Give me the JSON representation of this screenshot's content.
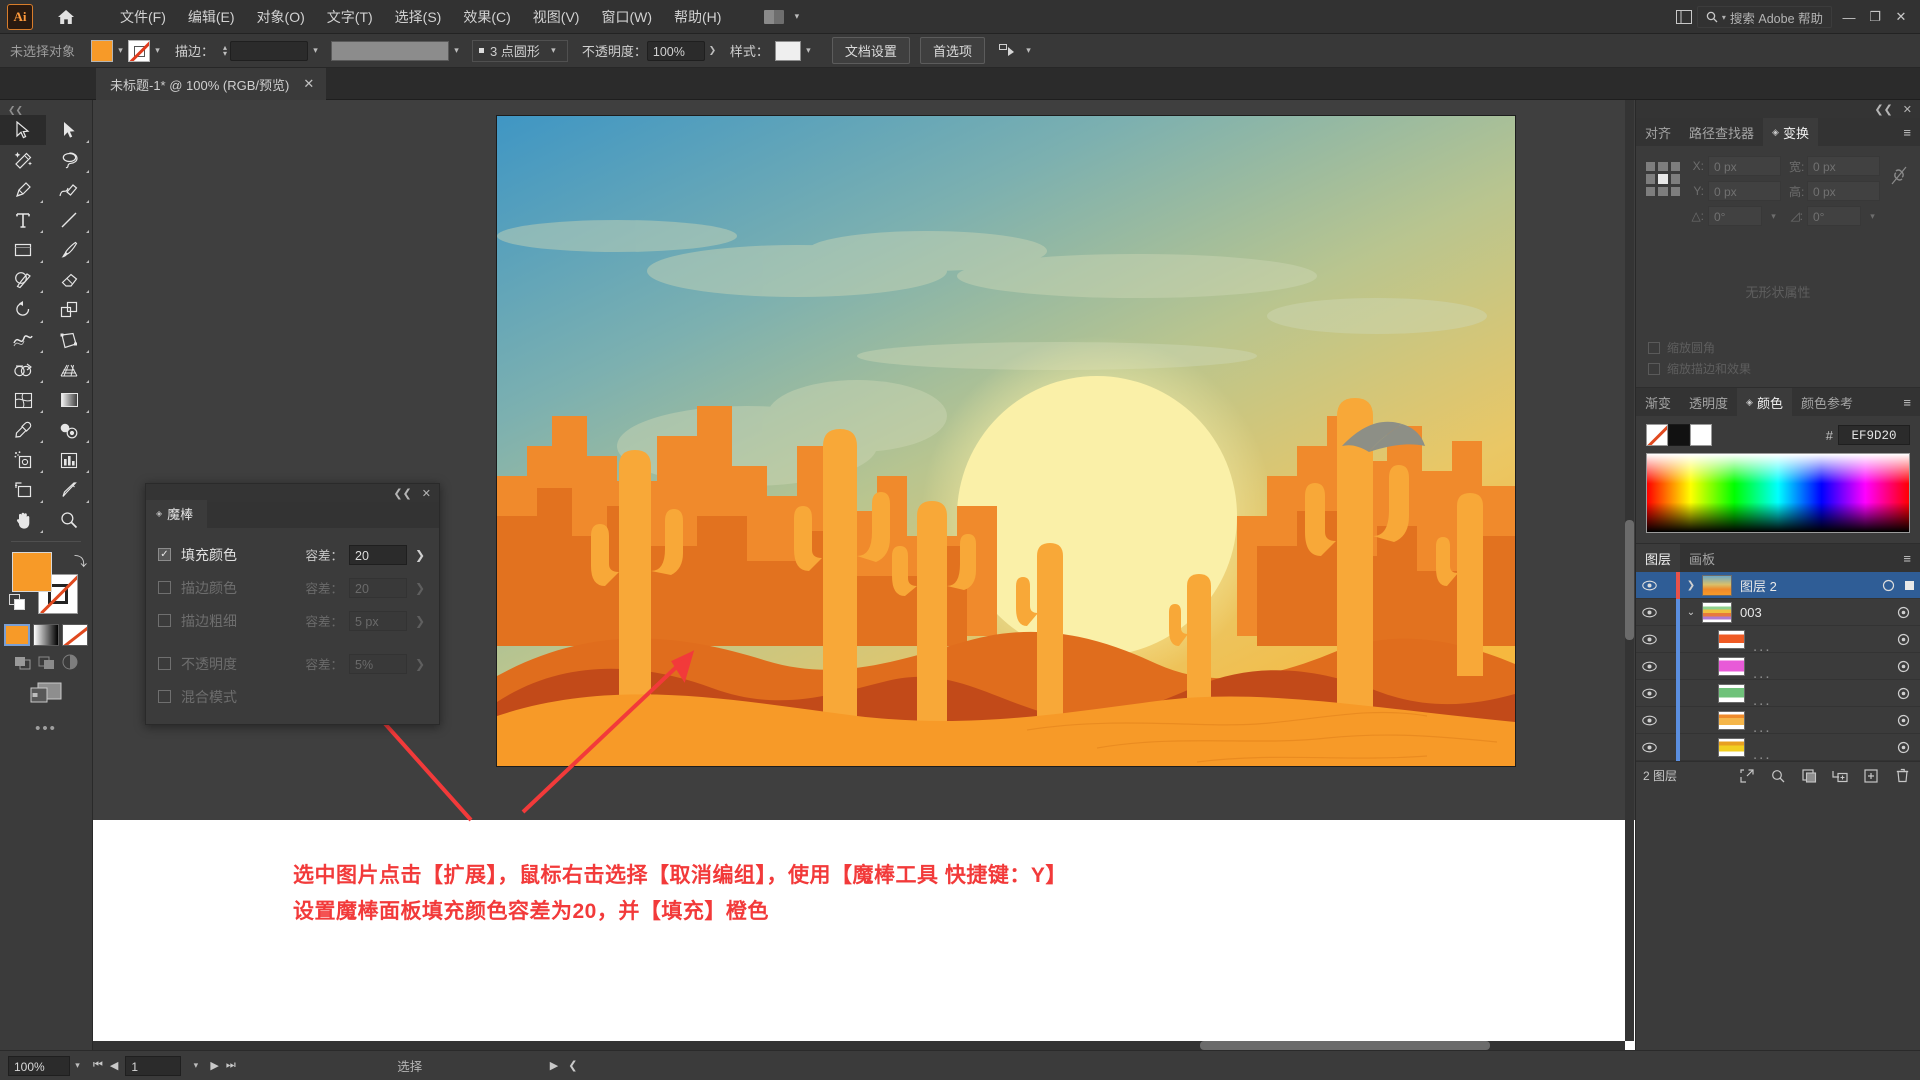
{
  "app": {
    "logo": "Ai",
    "home_icon": "home-icon"
  },
  "menubar": {
    "items": [
      "文件(F)",
      "编辑(E)",
      "对象(O)",
      "文字(T)",
      "选择(S)",
      "效果(C)",
      "视图(V)",
      "窗口(W)",
      "帮助(H)"
    ],
    "workspace_switcher": "workspace-icon",
    "search_placeholder": "搜索 Adobe 帮助",
    "panel_toggle_icon": "panel-toggle-icon",
    "minimize": "—",
    "restore": "❐",
    "close": "✕"
  },
  "controlbar": {
    "selection_status": "未选择对象",
    "fill_color": "#F79A28",
    "stroke_color": "none",
    "stroke_label": "描边：",
    "stroke_weight": "",
    "stroke_profile": "",
    "brush_definition": "3 点圆形",
    "opacity_label": "不透明度：",
    "opacity_value": "100%",
    "style_label": "样式：",
    "document_setup": "文档设置",
    "preferences": "首选项",
    "align_icon": "align-icon"
  },
  "document_tab": {
    "title": "未标题-1* @ 100% (RGB/预览)",
    "close": "✕"
  },
  "toolbar": {
    "tools": [
      {
        "name": "selection-tool",
        "glyph": "selection",
        "selected": true
      },
      {
        "name": "direct-selection-tool",
        "glyph": "direct-selection",
        "selected": false
      },
      {
        "name": "magic-wand-tool",
        "glyph": "magic-wand",
        "selected": false
      },
      {
        "name": "lasso-tool",
        "glyph": "lasso",
        "selected": false
      },
      {
        "name": "pen-tool",
        "glyph": "pen",
        "selected": false
      },
      {
        "name": "curvature-tool",
        "glyph": "curvature",
        "selected": false
      },
      {
        "name": "type-tool",
        "glyph": "type",
        "selected": false
      },
      {
        "name": "line-segment-tool",
        "glyph": "line",
        "selected": false
      },
      {
        "name": "rectangle-tool",
        "glyph": "rectangle",
        "selected": false
      },
      {
        "name": "paintbrush-tool",
        "glyph": "paintbrush",
        "selected": false
      },
      {
        "name": "shaper-tool",
        "glyph": "shaper",
        "selected": false
      },
      {
        "name": "eraser-tool",
        "glyph": "eraser",
        "selected": false
      },
      {
        "name": "rotate-tool",
        "glyph": "rotate",
        "selected": false
      },
      {
        "name": "scale-tool",
        "glyph": "scale",
        "selected": false
      },
      {
        "name": "width-tool",
        "glyph": "width",
        "selected": false
      },
      {
        "name": "free-transform-tool",
        "glyph": "free-transform",
        "selected": false
      },
      {
        "name": "shape-builder-tool",
        "glyph": "shape-builder",
        "selected": false
      },
      {
        "name": "perspective-grid-tool",
        "glyph": "perspective-grid",
        "selected": false
      },
      {
        "name": "mesh-tool",
        "glyph": "mesh",
        "selected": false
      },
      {
        "name": "gradient-tool",
        "glyph": "gradient",
        "selected": false
      },
      {
        "name": "eyedropper-tool",
        "glyph": "eyedropper",
        "selected": false
      },
      {
        "name": "blend-tool",
        "glyph": "blend",
        "selected": false
      },
      {
        "name": "symbol-sprayer-tool",
        "glyph": "symbol-sprayer",
        "selected": false
      },
      {
        "name": "column-graph-tool",
        "glyph": "column-graph",
        "selected": false
      },
      {
        "name": "artboard-tool",
        "glyph": "artboard",
        "selected": false
      },
      {
        "name": "slice-tool",
        "glyph": "slice",
        "selected": false
      },
      {
        "name": "hand-tool",
        "glyph": "hand",
        "selected": false
      },
      {
        "name": "zoom-tool",
        "glyph": "zoom",
        "selected": false
      }
    ],
    "fill_swatch": "#F79A28",
    "stroke_swatch": "none",
    "modes": [
      "color-mode",
      "gradient-mode",
      "none-mode"
    ],
    "more_tools": "•••"
  },
  "magic_wand_panel": {
    "tab_label": "魔棒",
    "collapse": "❮❮",
    "close": "✕",
    "rows": [
      {
        "label": "填充颜色",
        "checked": true,
        "tol_label": "容差：",
        "value": "20",
        "enabled": true
      },
      {
        "label": "描边颜色",
        "checked": false,
        "tol_label": "容差：",
        "value": "20",
        "enabled": false
      },
      {
        "label": "描边粗细",
        "checked": false,
        "tol_label": "容差：",
        "value": "5 px",
        "enabled": false
      },
      {
        "label": "不透明度",
        "checked": false,
        "tol_label": "容差：",
        "value": "5%",
        "enabled": false
      },
      {
        "label": "混合模式",
        "checked": false,
        "tol_label": "",
        "value": "",
        "enabled": false
      }
    ]
  },
  "transform_panel": {
    "collapse": "❮❮",
    "close": "✕",
    "tabs": [
      {
        "label": "对齐",
        "active": false
      },
      {
        "label": "路径查找器",
        "active": false
      },
      {
        "label": "变换",
        "active": true
      }
    ],
    "menu_icon": "panel-menu-icon",
    "fields": [
      {
        "key": "X:",
        "value": "0 px"
      },
      {
        "key": "宽:",
        "value": "0 px"
      },
      {
        "key": "Y:",
        "value": "0 px"
      },
      {
        "key": "高:",
        "value": "0 px"
      },
      {
        "key": "△:",
        "value": "0°"
      },
      {
        "key": "◿:",
        "value": "0°"
      }
    ],
    "link_icon": "link-broken-icon",
    "empty_text": "无形状属性",
    "checkboxes": [
      "缩放圆角",
      "缩放描边和效果"
    ]
  },
  "color_panel": {
    "tabs": [
      {
        "label": "渐变",
        "active": false
      },
      {
        "label": "透明度",
        "active": false
      },
      {
        "label": "颜色",
        "active": true
      },
      {
        "label": "颜色参考",
        "active": false
      }
    ],
    "menu_icon": "panel-menu-icon",
    "hash": "#",
    "hex": "EF9D20",
    "swatches": [
      "none",
      "black",
      "white"
    ]
  },
  "layers_panel": {
    "tabs": [
      {
        "label": "图层",
        "active": true
      },
      {
        "label": "画板",
        "active": false
      }
    ],
    "menu_icon": "panel-menu-icon",
    "rows": [
      {
        "name": "图层 2",
        "indent": 0,
        "selected": true,
        "has_twist": true,
        "twist": "❯",
        "thumb": "art-thumb",
        "color": "#e8524a",
        "locked": false
      },
      {
        "name": "003",
        "indent": 1,
        "selected": false,
        "has_twist": true,
        "twist": "⌄",
        "thumb": "group-thumb",
        "color": "#5b8fe0",
        "locked": false
      },
      {
        "name": "...",
        "indent": 2,
        "selected": false,
        "has_twist": false,
        "twist": "",
        "thumb": "path-thumb-red",
        "color": "#5b8fe0",
        "locked": false
      },
      {
        "name": "...",
        "indent": 2,
        "selected": false,
        "has_twist": false,
        "twist": "",
        "thumb": "path-thumb-magenta",
        "color": "#5b8fe0",
        "locked": false
      },
      {
        "name": "...",
        "indent": 2,
        "selected": false,
        "has_twist": false,
        "twist": "",
        "thumb": "path-thumb-green",
        "color": "#5b8fe0",
        "locked": false
      },
      {
        "name": "...",
        "indent": 2,
        "selected": false,
        "has_twist": false,
        "twist": "",
        "thumb": "path-thumb-orange",
        "color": "#5b8fe0",
        "locked": false
      },
      {
        "name": "...",
        "indent": 2,
        "selected": false,
        "has_twist": false,
        "twist": "",
        "thumb": "path-thumb-yellow",
        "color": "#5b8fe0",
        "locked": false
      }
    ],
    "footer_count": "2 图层",
    "footer_icons": [
      "locate-object-icon",
      "make-clipping-mask-icon",
      "create-sublayer-icon",
      "new-layer-icon",
      "delete-layer-icon"
    ]
  },
  "annotation": {
    "line1": "选中图片点击【扩展】，鼠标右击选择【取消编组】，使用【魔棒工具 快捷键：Y】",
    "line2": "设置魔棒面板填充颜色容差为20，并【填充】橙色",
    "color": "#F23A3A"
  },
  "statusbar": {
    "zoom": "100%",
    "page": "1",
    "mode": "选择",
    "first_icon": "first-page-icon",
    "prev_icon": "prev-page-icon",
    "next_icon": "next-page-icon",
    "last_icon": "last-page-icon"
  },
  "artwork": {
    "title": "desert-sunset-illustration",
    "sky_top": "#4E9BC4",
    "sky_mid": "#9FC09B",
    "sky_warm": "#F2CF6B",
    "sun": "#FAF0A8",
    "dune_front": "#F79A28",
    "dune_mid": "#E8761E",
    "dune_dark": "#C0461A",
    "cactus": "#F8A838"
  }
}
